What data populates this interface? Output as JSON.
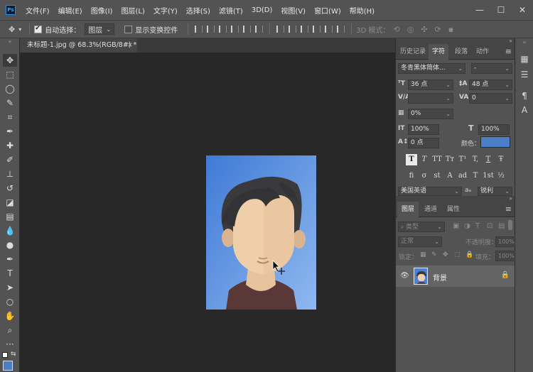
{
  "menubar": {
    "logo": "Ps",
    "items": [
      "文件(F)",
      "编辑(E)",
      "图像(I)",
      "图层(L)",
      "文字(Y)",
      "选择(S)",
      "滤镜(T)",
      "3D(D)",
      "视图(V)",
      "窗口(W)",
      "帮助(H)"
    ],
    "window_controls": [
      "—",
      "☐",
      "✕"
    ]
  },
  "options": {
    "auto_select_label": "自动选择：",
    "auto_select_value": "图层",
    "show_transform_label": "显示变换控件",
    "mode_3d_label": "3D 模式："
  },
  "document": {
    "tab_title": "未标题-1.jpg @ 68.3%(RGB/8#) *",
    "close": "×"
  },
  "character_panel": {
    "tabs": [
      "历史记录",
      "字符",
      "段落",
      "动作"
    ],
    "active_tab": "字符",
    "font_family": "冬青黑体简体...",
    "font_style": "-",
    "font_size": "36 点",
    "leading": "48 点",
    "kerning": "",
    "tracking": "0",
    "scale_percent": "0%",
    "vertical_scale": "100%",
    "horizontal_scale": "100%",
    "baseline_shift": "0 点",
    "color_label": "颜色：",
    "color_value": "#4a7fc8",
    "style_buttons": [
      "T",
      "T",
      "TT",
      "Tт",
      "T¹",
      "T,",
      "T",
      "Ŧ"
    ],
    "opentype_buttons": [
      "fi",
      "σ",
      "st",
      "A",
      "ad",
      "T",
      "1st",
      "½"
    ],
    "language": "美国英语",
    "antialias": "锐利",
    "aa_label": "aₐ"
  },
  "layers_panel": {
    "tabs": [
      "图层",
      "通道",
      "属性"
    ],
    "active_tab": "图层",
    "filter_kind": "类型",
    "blend_mode": "正常",
    "opacity_label": "不透明度：",
    "opacity_value": "100%",
    "lock_label": "锁定：",
    "fill_label": "填充：",
    "fill_value": "100%",
    "layers": [
      {
        "name": "背景",
        "visible": true,
        "locked": true
      }
    ]
  }
}
